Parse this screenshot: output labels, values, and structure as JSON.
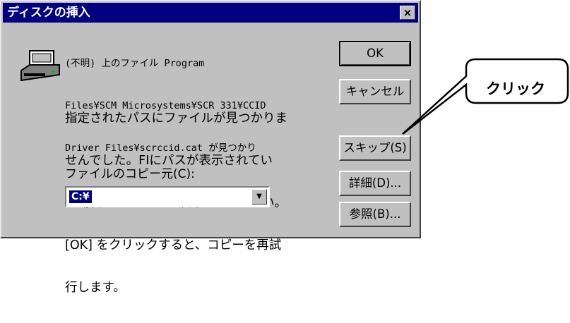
{
  "dialog": {
    "title": "ディスクの挿入",
    "close_symbol": "×",
    "message_lines": [
      "(不明) 上のファイル Program",
      "Files¥SCM Microsystems¥SCR 331¥CCID",
      "Driver Files¥scrccid.cat が見つかり"
    ],
    "instruction_lines": [
      "指定されたパスにファイルが見つかりま",
      "せんでした。FIにパスが表示されてい",
      "る場合は、正しいか確認してください。",
      "[OK] をクリックすると、コピーを再試",
      "行します。"
    ],
    "copy_from_label": "ファイルのコピー元(C):",
    "copy_from_value": "C:¥",
    "combo_arrow": "▼",
    "buttons": {
      "ok": "OK",
      "cancel": "キャンセル",
      "skip": "スキップ(S)",
      "details": "詳細(D)...",
      "browse": "参照(B)..."
    }
  },
  "callout": {
    "label": "クリック"
  }
}
